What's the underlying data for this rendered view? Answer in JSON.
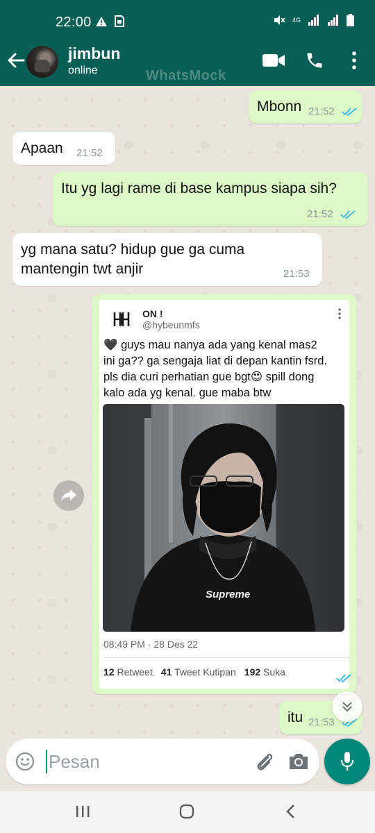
{
  "status_bar": {
    "time": "22:00",
    "network": "4G"
  },
  "header": {
    "contact_name": "jimbun",
    "contact_status": "online",
    "watermark": "WhatsMock",
    "colors": {
      "header_bg": "#075e54",
      "outgoing_bubble": "#dcf8c6",
      "incoming_bubble": "#ffffff",
      "read_ticks": "#34b7f1",
      "mic_button": "#00897b"
    }
  },
  "messages": [
    {
      "direction": "out",
      "text": "Mbonn",
      "time": "21:52",
      "status": "read"
    },
    {
      "direction": "in",
      "text": "Apaan",
      "time": "21:52"
    },
    {
      "direction": "out",
      "text": "Itu yg lagi rame di base kampus siapa sih?",
      "time": "21:52",
      "status": "read"
    },
    {
      "direction": "in",
      "text_line1": "yg mana satu? hidup gue ga cuma",
      "text_line2": "mantengin twt anjir",
      "time": "21:53"
    },
    {
      "direction": "out",
      "type": "image",
      "status": "read"
    },
    {
      "direction": "out",
      "text": "itu",
      "time": "21:53",
      "status": "read"
    }
  ],
  "tweet": {
    "account_name": "ON !",
    "handle": "@hybeunmfs",
    "text_line1": "🖤 guys mau nanya ada yang kenal mas2",
    "text_line2": "ini ga?? ga sengaja liat di depan kantin fsrd.",
    "text_line3": "pls dia curi perhatian gue bgt😍 spill dong",
    "text_line4": "kalo ada yg kenal. gue maba btw",
    "photo_shirt_text": "Supreme",
    "timestamp": "08:49 PM · 28 Des 22",
    "retweet_count": "12",
    "retweet_label": "Retweet",
    "quote_count": "41",
    "quote_label": "Tweet Kutipan",
    "like_count": "192",
    "like_label": "Suka"
  },
  "composer": {
    "placeholder": "Pesan"
  },
  "icons": {
    "back": "arrow-left-icon",
    "video": "video-camera-icon",
    "call": "phone-icon",
    "menu": "more-vertical-icon",
    "emoji": "emoji-icon",
    "attach": "paperclip-icon",
    "camera": "camera-icon",
    "mic": "microphone-icon",
    "forward": "forward-icon",
    "scroll": "double-chevron-down-icon"
  }
}
